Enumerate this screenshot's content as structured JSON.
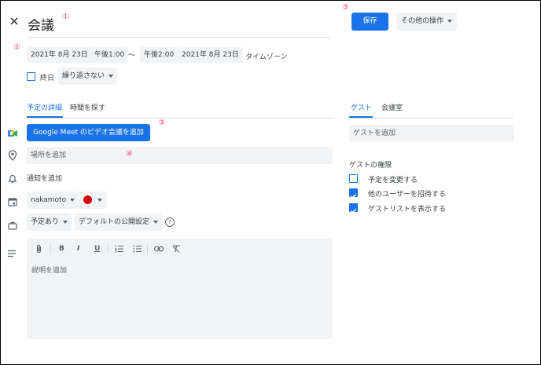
{
  "header": {
    "title": "会議",
    "save_label": "保存",
    "more_actions_label": "その他の操作"
  },
  "datetime": {
    "start_date": "2021年 8月 23日",
    "start_time": "午後1:00",
    "separator": "〜",
    "end_time": "午後2:00",
    "end_date": "2021年 8月 23日",
    "timezone_label": "タイムゾーン",
    "allday_label": "終日",
    "repeat_label": "繰り返さない"
  },
  "markers": {
    "m1": "①",
    "m2": "②",
    "m3": "③",
    "m4": "④",
    "m5": "⑤"
  },
  "tabs": {
    "details": "予定の詳細",
    "find_time": "時間を探す"
  },
  "details": {
    "meet_button": "Google Meet のビデオ会議を追加",
    "location_placeholder": "場所を追加",
    "notification_label": "通知を追加",
    "calendar_owner": "nakamoto",
    "event_color": "#d50000",
    "availability": "予定あり",
    "visibility": "デフォルトの公開設定",
    "help_glyph": "?",
    "description_placeholder": "説明を追加"
  },
  "toolbar": {
    "attach": "attach-icon",
    "bold": "B",
    "italic": "I",
    "underline": "U",
    "numbered_list": "numbered-list-icon",
    "bulleted_list": "bulleted-list-icon",
    "link": "link-icon",
    "clear_format": "clear-format-icon"
  },
  "guests_panel": {
    "tab_guests": "ゲスト",
    "tab_rooms": "会議室",
    "add_guests_placeholder": "ゲストを追加",
    "permissions_title": "ゲストの権限",
    "permissions": [
      {
        "label": "予定を変更する",
        "checked": false
      },
      {
        "label": "他のユーザーを招待する",
        "checked": true
      },
      {
        "label": "ゲストリストを表示する",
        "checked": true
      }
    ]
  },
  "colors": {
    "accent": "#1a73e8",
    "marker": "#e8437b",
    "chip_bg": "#f1f3f4"
  }
}
